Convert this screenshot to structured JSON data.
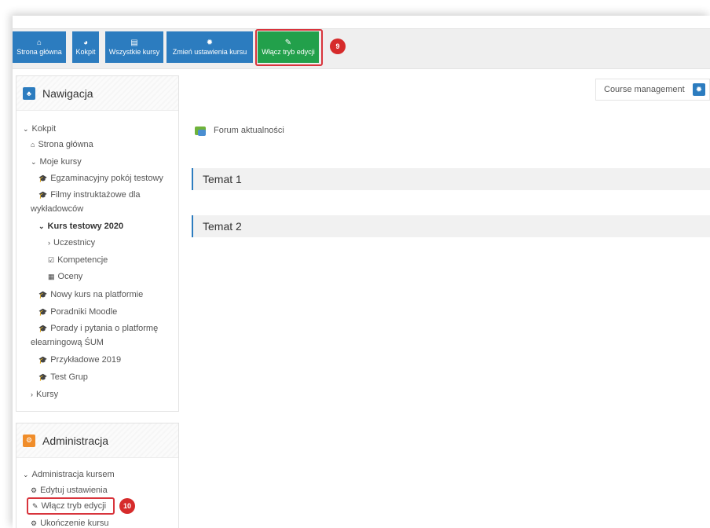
{
  "toolbar": {
    "buttons": [
      {
        "label": "Strona główna",
        "icon": "home-icon",
        "glyph": "⌂"
      },
      {
        "label": "Kokpit",
        "icon": "dashboard-icon",
        "glyph": "◕"
      },
      {
        "label": "Wszystkie kursy",
        "icon": "book-icon",
        "glyph": "▤"
      },
      {
        "label": "Zmień ustawienia kursu",
        "icon": "gear-icon",
        "glyph": "✹"
      },
      {
        "label": "Włącz tryb edycji",
        "icon": "edit-icon",
        "glyph": "✎"
      }
    ],
    "badge": "9"
  },
  "navigation": {
    "title": "Nawigacja",
    "icon_glyph": "♣",
    "items": [
      {
        "label": "Kokpit",
        "glyph": "⌄"
      },
      {
        "label": "Strona główna",
        "glyph": "⌂"
      },
      {
        "label": "Moje kursy",
        "glyph": "⌄"
      },
      {
        "label": "Egzaminacyjny pokój testowy",
        "glyph": "🎓"
      },
      {
        "label": "Filmy instruktażowe dla",
        "glyph": "🎓"
      },
      {
        "label": "wykładowców",
        "glyph": ""
      },
      {
        "label": "Kurs testowy 2020",
        "glyph": "⌄"
      },
      {
        "label": "Uczestnicy",
        "glyph": "›"
      },
      {
        "label": "Kompetencje",
        "glyph": "☑"
      },
      {
        "label": "Oceny",
        "glyph": "▦"
      },
      {
        "label": "Nowy kurs na platformie",
        "glyph": "🎓"
      },
      {
        "label": "Poradniki Moodle",
        "glyph": "🎓"
      },
      {
        "label": "Porady i pytania o platformę",
        "glyph": "🎓"
      },
      {
        "label": "elearningową ŚUM",
        "glyph": ""
      },
      {
        "label": "Przykładowe 2019",
        "glyph": "🎓"
      },
      {
        "label": "Test Grup",
        "glyph": "🎓"
      },
      {
        "label": "Kursy",
        "glyph": "›"
      }
    ]
  },
  "administration": {
    "title": "Administracja",
    "icon_glyph": "⚙",
    "items": [
      {
        "label": "Administracja kursem",
        "glyph": "⌄"
      },
      {
        "label": "Edytuj ustawienia",
        "glyph": "⚙"
      },
      {
        "label": "Włącz tryb edycji",
        "glyph": "✎"
      },
      {
        "label": "Ukończenie kursu",
        "glyph": "⚙"
      }
    ],
    "badge": "10"
  },
  "main": {
    "course_management": "Course management",
    "forum": "Forum aktualności",
    "sections": [
      "Temat 1",
      "Temat 2"
    ]
  },
  "colors": {
    "primary": "#2c7cbf",
    "edit_green": "#22a04b",
    "highlight_red": "#d8343c",
    "admin_orange": "#f08d2a"
  }
}
